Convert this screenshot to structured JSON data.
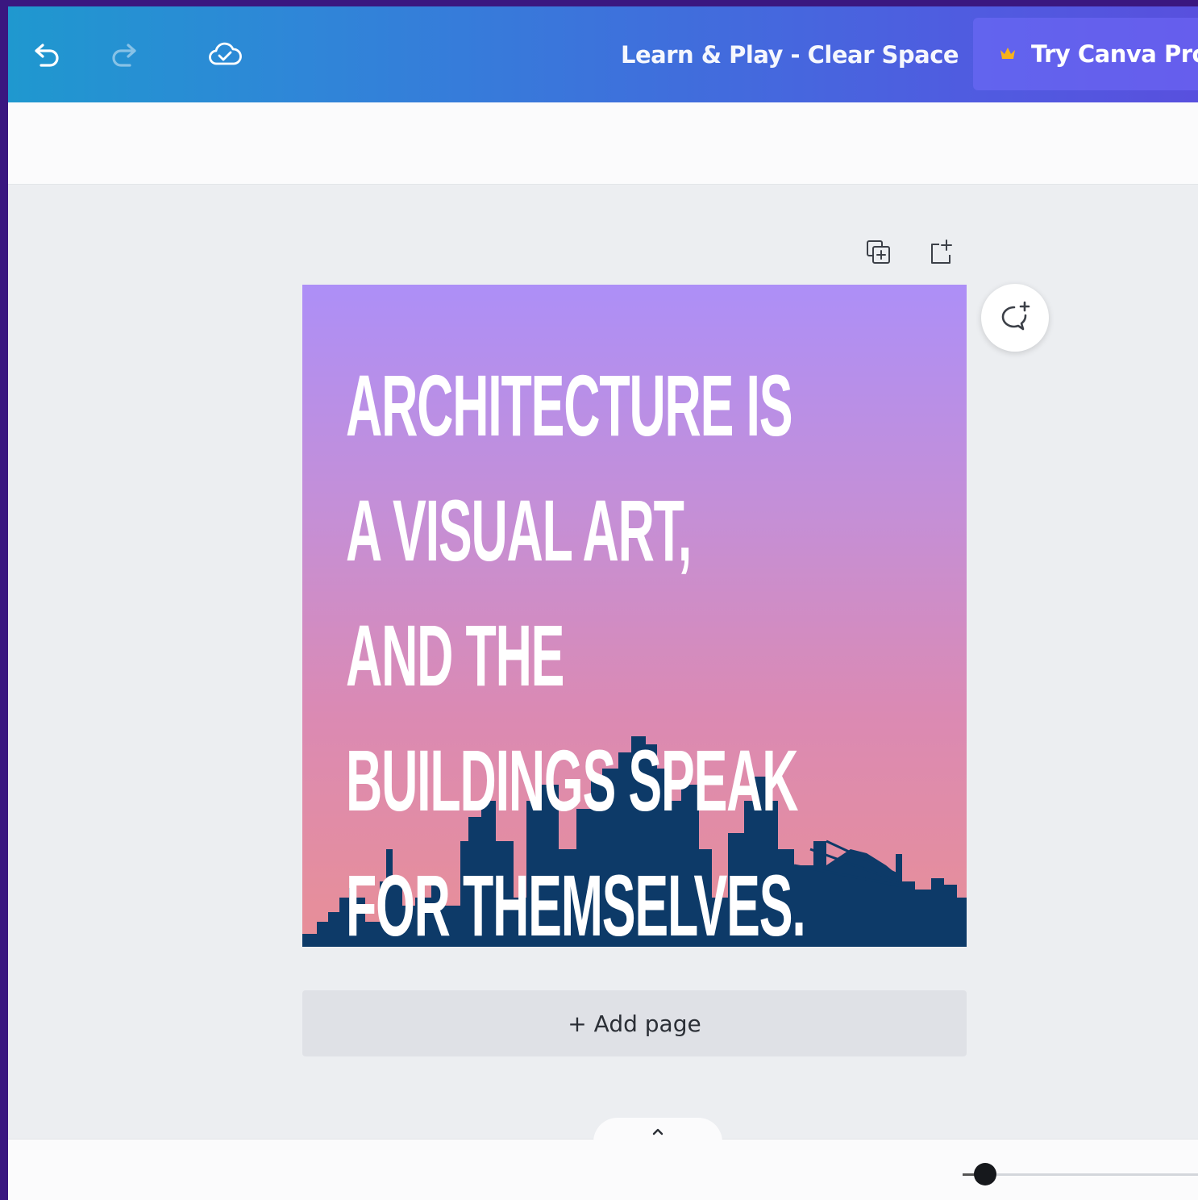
{
  "window": {
    "document_title": "Learn & Play - Clear Space",
    "pro_button_label": "Try Canva Pro"
  },
  "toolbar": {
    "icons": [
      "undo-icon",
      "redo-icon",
      "cloud-saved-icon"
    ]
  },
  "page_tools": {
    "icons": [
      "duplicate-page-icon",
      "add-page-icon"
    ]
  },
  "design": {
    "quote_lines": [
      "ARCHITECTURE IS",
      "A VISUAL ART,",
      "AND THE",
      "BUILDINGS SPEAK",
      "FOR THEMSELVES."
    ],
    "colors": {
      "gradient_top": "#ad8ff7",
      "gradient_bottom": "#e88f97",
      "skyline": "#0d3a68",
      "text": "#ffffff"
    }
  },
  "add_page_label": "+ Add page",
  "bottom": {
    "zoom_level_fraction": 0.05
  },
  "colors": {
    "topbar_start": "#1f98cf",
    "topbar_end": "#5850de",
    "outer_frame": "#3a1780"
  }
}
